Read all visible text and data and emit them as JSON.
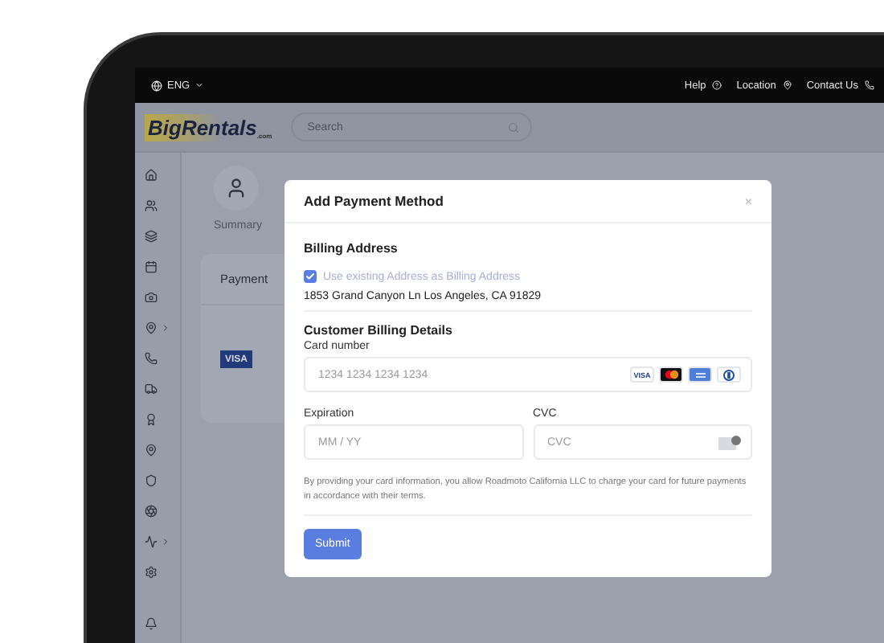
{
  "topbar": {
    "language": "ENG",
    "links": [
      {
        "label": "Help",
        "kind": "help"
      },
      {
        "label": "Location",
        "kind": "location"
      },
      {
        "label": "Contact Us",
        "kind": "phone"
      }
    ]
  },
  "header": {
    "logo": "BigRentals",
    "logo_sub": ".com",
    "search": {
      "placeholder": "Search"
    }
  },
  "sidebar": {
    "items": [
      {
        "expandable": false
      },
      {
        "expandable": false
      },
      {
        "expandable": false
      },
      {
        "expandable": false
      },
      {
        "expandable": false
      },
      {
        "expandable": true
      },
      {
        "expandable": false
      },
      {
        "expandable": false
      },
      {
        "expandable": false
      },
      {
        "expandable": false
      },
      {
        "expandable": false
      },
      {
        "expandable": false
      },
      {
        "expandable": true
      },
      {
        "expandable": false
      }
    ]
  },
  "background": {
    "profile_tab": "Summary",
    "card_title": "Payment",
    "card_brand": "VISA"
  },
  "modal": {
    "title": "Add Payment Method",
    "close": "×",
    "billing_title": "Billing Address",
    "use_existing": {
      "label": "Use existing Address as Billing Address",
      "checked": true
    },
    "address": "1853 Grand Canyon Ln Los Angeles, CA 91829",
    "details_title": "Customer Billing Details",
    "card_number": {
      "label": "Card number",
      "placeholder": "1234 1234 1234 1234",
      "brands": [
        {
          "kind": "visa",
          "label": "VISA"
        },
        {
          "kind": "mastercard"
        },
        {
          "kind": "amex"
        },
        {
          "kind": "diners"
        }
      ]
    },
    "expiration": {
      "label": "Expiration",
      "placeholder": "MM / YY"
    },
    "cvc": {
      "label": "CVC",
      "placeholder": "CVC"
    },
    "disclaimer": "By providing your card information, you allow Roadmoto California LLC to charge your card for future payments in accordance with their terms.",
    "submit": "Submit"
  }
}
